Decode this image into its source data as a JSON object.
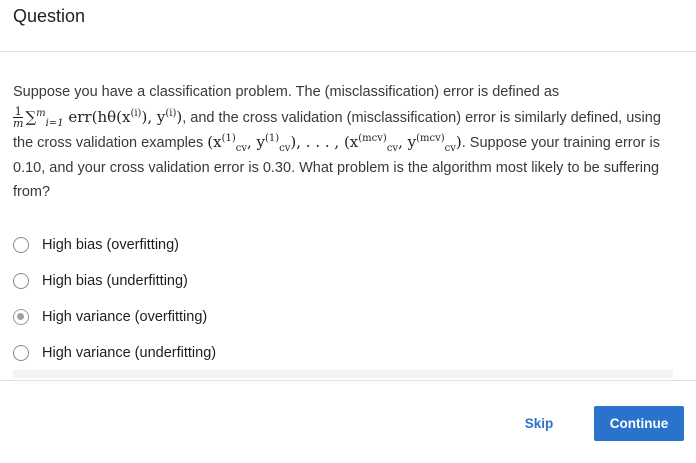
{
  "header": {
    "title": "Question"
  },
  "question": {
    "text_1": "Suppose you have a classification problem. The (misclassification) error is defined as",
    "formula_frac_num": "1",
    "formula_frac_den": "m",
    "formula_1": "∑",
    "formula_1_sup": "m",
    "formula_1_sub": "i=1",
    "formula_1_rest": "err(hθ(x",
    "formula_1_rest_sup": "(i)",
    "formula_1_rest_2": "), y",
    "formula_1_rest_2_sup": "(i)",
    "formula_1_rest_3": ")",
    "text_2": ", and the cross validation (misclassification) error is similarly defined, using the cross validation examples",
    "formula_2": "(x",
    "formula_2_sub_a": "cv",
    "formula_2_sup_a": "(1)",
    "formula_2_mid_a": ", y",
    "formula_2_sub_b": "cv",
    "formula_2_sup_b": "(1)",
    "formula_2_mid_b": "), . . . , (x",
    "formula_2_sub_c": "cv",
    "formula_2_sup_c": "(mcv)",
    "formula_2_mid_c": ", y",
    "formula_2_sub_d": "cv",
    "formula_2_sup_d": "(mcv)",
    "formula_2_end": ")",
    "text_3": ". Suppose your training error is 0.10, and your cross validation error is 0.30. What problem is the algorithm most likely to be suffering from?"
  },
  "options": [
    {
      "label": "High bias (overfitting)",
      "selected": false
    },
    {
      "label": "High bias (underfitting)",
      "selected": false
    },
    {
      "label": "High variance (overfitting)",
      "selected": true
    },
    {
      "label": "High variance (underfitting)",
      "selected": false
    }
  ],
  "footer": {
    "skip_label": "Skip",
    "continue_label": "Continue"
  },
  "colors": {
    "accent": "#2a73cc",
    "divider": "#e1e1e1",
    "radio_selected": "#a2a2a2"
  }
}
